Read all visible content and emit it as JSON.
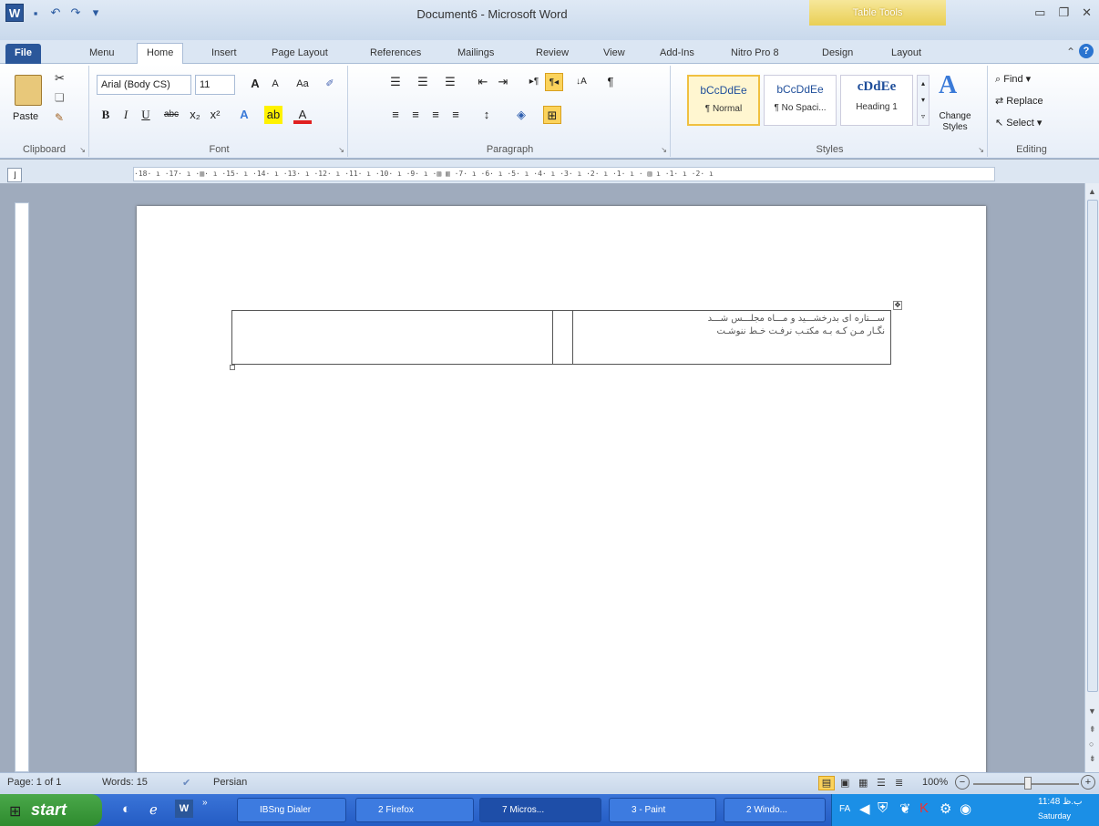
{
  "title": "Document6 - Microsoft Word",
  "table_tools": "Table Tools",
  "tabs": [
    "File",
    "Menu",
    "Home",
    "Insert",
    "Page Layout",
    "References",
    "Mailings",
    "Review",
    "View",
    "Add-Ins",
    "Nitro Pro 8",
    "Design",
    "Layout"
  ],
  "clipboard": {
    "paste": "Paste",
    "label": "Clipboard"
  },
  "font": {
    "name": "Arial (Body CS)",
    "size": "11",
    "label": "Font"
  },
  "paragraph": {
    "label": "Paragraph"
  },
  "styles": {
    "label": "Styles",
    "items": [
      {
        "sample": "bCcDdEe",
        "name": "¶ Normal"
      },
      {
        "sample": "bCcDdEe",
        "name": "¶ No Spaci..."
      },
      {
        "sample": "cDdEe",
        "name": "Heading 1"
      }
    ],
    "change": "Change Styles"
  },
  "editing": {
    "find": "Find",
    "replace": "Replace",
    "select": "Select",
    "label": "Editing"
  },
  "ruler": {
    "marks": "·18· ı ·17· ı ·▥· ı ·15· ı ·14· ı ·13· ı ·12· ı ·11· ı ·10· ı ·9· ı ·▥ ▥ ·7· ı ·6· ı ·5· ı ·4· ı ·3· ı ·2· ı ·1· ı · ▥ ı ·1· ı ·2· ı"
  },
  "table": {
    "line1": "ســـتاره ای بدرخشـــید و مـــاه مجلـــس شـــد",
    "line2": "نگـار مـن کـه بـه مکتـب نرفـت خـط ننوشـت"
  },
  "status": {
    "page": "Page: 1 of 1",
    "words": "Words: 15",
    "language": "Persian",
    "zoom": "100%"
  },
  "taskbar": {
    "start": "start",
    "items": [
      "IBSng Dialer",
      "2 Firefox",
      "7 Micros...",
      "3 - Paint",
      "2 Windo..."
    ],
    "lang": "FA",
    "time": "11:48 ب.ظ",
    "day": "Saturday"
  }
}
